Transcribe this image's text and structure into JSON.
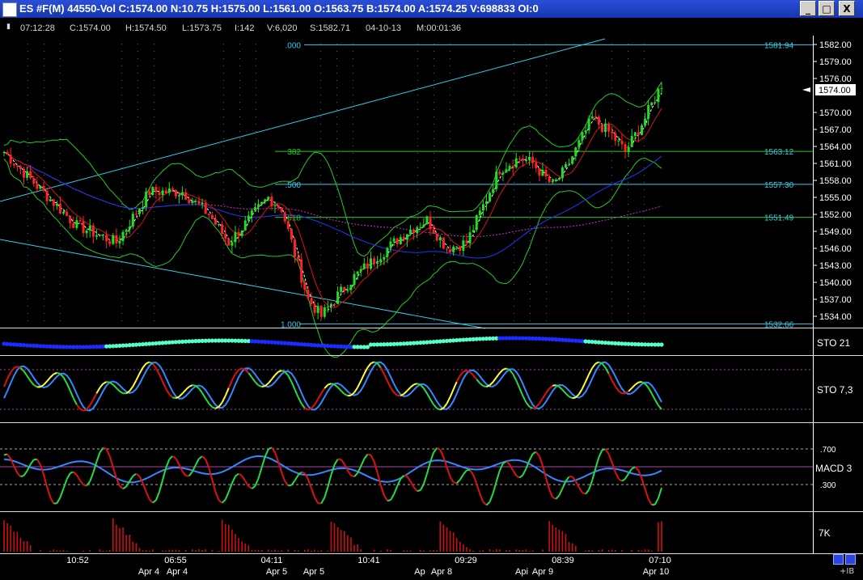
{
  "window": {
    "title": "ES #F(M) 44550-Vol C:1574.00 N:10.75 H:1575.00 L:1561.00 O:1563.75 B:1574.00 A:1574.25 V:698833 OI:0",
    "buttons": [
      "_",
      "□",
      "X"
    ]
  },
  "quote_bar": {
    "time": "07:12:28",
    "close": "C:1574.00",
    "high": "H:1574.50",
    "low": "L:1573.75",
    "ticks": "I:142",
    "volume": "V:6,020",
    "s_value": "S:1582.71",
    "date": "04-10-13",
    "duration": "M:00:01:36"
  },
  "price_axis": {
    "ticks": [
      "1582.00",
      "1579.00",
      "1576.00",
      "1570.00",
      "1567.00",
      "1564.00",
      "1561.00",
      "1558.00",
      "1555.00",
      "1552.00",
      "1549.00",
      "1546.00",
      "1543.00",
      "1540.00",
      "1537.00",
      "1534.00"
    ],
    "last_price": "1574.00"
  },
  "fibonacci": {
    "levels": [
      ".000",
      "382",
      ".500",
      ".618",
      "1.000"
    ],
    "prices": [
      "1581.94",
      "1563.12",
      "1557.30",
      "1551.49",
      "1532.66"
    ]
  },
  "panels": {
    "sto_21_label": "STO 21",
    "sto_7_label": "STO 7,3",
    "macd_label": "MACD 3",
    "macd_levels": [
      ".700",
      ".300"
    ],
    "volume_label": "7K"
  },
  "time_axis": {
    "times": [
      "10:52",
      "06:55",
      "04:11",
      "10:41",
      "09:29",
      "08:39",
      "07:10"
    ],
    "dates": [
      "Apr 4",
      "Apr 4",
      "Apr 5",
      "Apr 5",
      "Apr 8",
      "Apr 9",
      "Apr 10"
    ],
    "partial_dates": [
      "Ap",
      "Api"
    ]
  },
  "corner_label": "+IB",
  "colors": {
    "title_blue": "#1d3fc4",
    "up_candle": "#22dd22",
    "down_candle": "#ff2222",
    "fib_line": "#33ccee",
    "bollinger": "#22cc22",
    "ma_red": "#dd1111",
    "ma_blue": "#1f38ff",
    "ma_magenta": "#cc33cc",
    "sto_blue": "#3388ff",
    "sto_yellow": "#ffff33"
  }
}
